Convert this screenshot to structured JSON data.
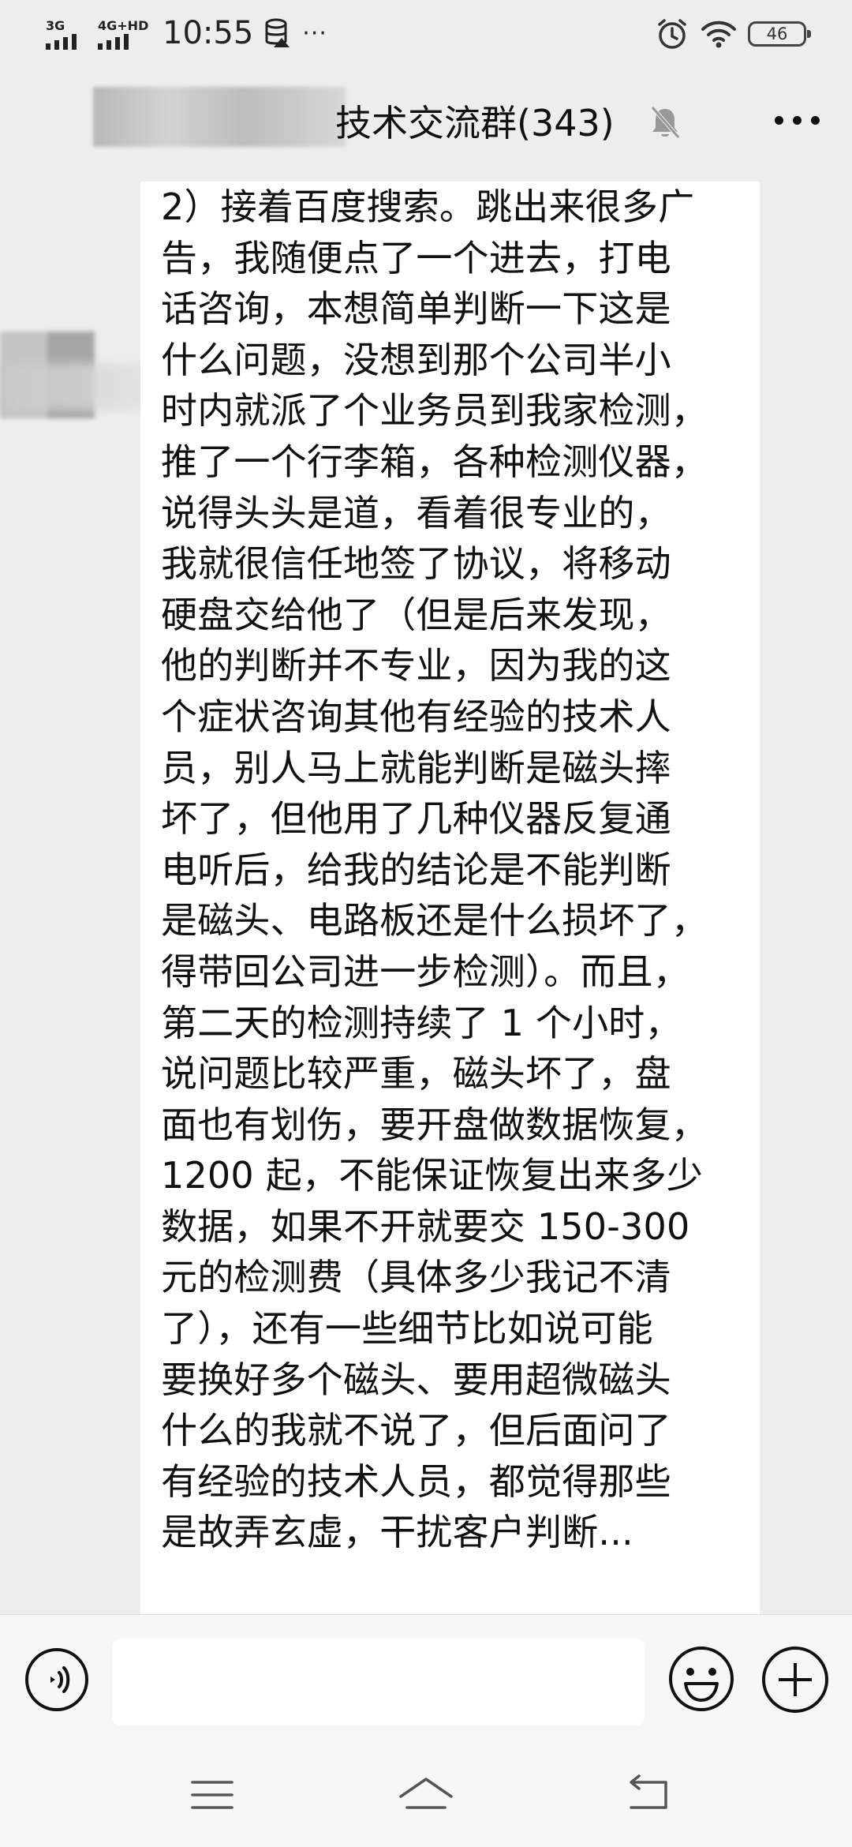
{
  "status_bar": {
    "sim1_label": "3G",
    "sim2_label": "4G+HD",
    "time": "10:55",
    "more": "···",
    "battery_level": "46",
    "icons": [
      "signal-icon",
      "database-icon",
      "alarm-icon",
      "wifi-icon",
      "battery-icon"
    ]
  },
  "header": {
    "title": "技术交流群(343)",
    "mute_icon": "bell-muted-icon",
    "more_icon": "more-dots-icon"
  },
  "message": {
    "lines": [
      "2）接着百度搜索。跳出来很多广",
      "告，我随便点了一个进去，打电",
      "话咨询，本想简单判断一下这是",
      "什么问题，没想到那个公司半小",
      "时内就派了个业务员到我家检测，",
      "推了一个行李箱，各种检测仪器，",
      "说得头头是道，看着很专业的，",
      "我就很信任地签了协议，将移动",
      "硬盘交给他了（但是后来发现，",
      "他的判断并不专业，因为我的这",
      "个症状咨询其他有经验的技术人",
      "员，别人马上就能判断是磁头摔",
      "坏了，但他用了几种仪器反复通",
      "电听后，给我的结论是不能判断",
      "是磁头、电路板还是什么损坏了，",
      "得带回公司进一步检测）。而且，",
      "第二天的检测持续了 1 个小时，",
      "说问题比较严重，磁头坏了，盘",
      "面也有划伤，要开盘做数据恢复，",
      "1200 起，不能保证恢复出来多少",
      "数据，如果不开就要交 150-300",
      "元的检测费（具体多少我记不清",
      "了），还有一些细节比如说可能",
      "要换好多个磁头、要用超微磁头",
      "什么的我就不说了，但后面问了",
      "有经验的技术人员，都觉得那些",
      "是故弄玄虚，干扰客户判断..."
    ]
  },
  "input_bar": {
    "input_value": "",
    "voice_icon": "voice-icon",
    "emoji_icon": "emoji-icon",
    "plus_icon": "plus-icon"
  },
  "nav_bar": {
    "icons": [
      "menu-icon",
      "home-icon",
      "back-icon"
    ]
  },
  "colors": {
    "background": "#ededed",
    "bubble": "#ffffff",
    "text": "#111111",
    "input_bar": "#f7f7f7"
  }
}
